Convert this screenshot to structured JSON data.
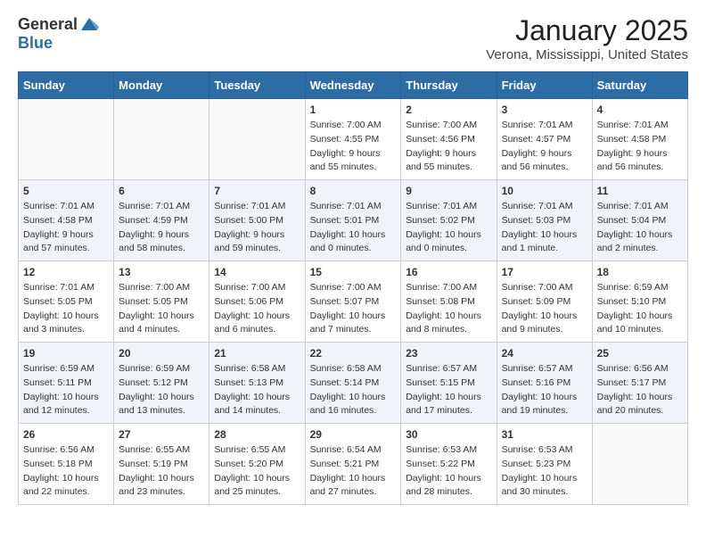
{
  "header": {
    "logo_line1": "General",
    "logo_line2": "Blue",
    "month": "January 2025",
    "location": "Verona, Mississippi, United States"
  },
  "weekdays": [
    "Sunday",
    "Monday",
    "Tuesday",
    "Wednesday",
    "Thursday",
    "Friday",
    "Saturday"
  ],
  "weeks": [
    [
      {
        "day": "",
        "info": ""
      },
      {
        "day": "",
        "info": ""
      },
      {
        "day": "",
        "info": ""
      },
      {
        "day": "1",
        "info": "Sunrise: 7:00 AM\nSunset: 4:55 PM\nDaylight: 9 hours\nand 55 minutes."
      },
      {
        "day": "2",
        "info": "Sunrise: 7:00 AM\nSunset: 4:56 PM\nDaylight: 9 hours\nand 55 minutes."
      },
      {
        "day": "3",
        "info": "Sunrise: 7:01 AM\nSunset: 4:57 PM\nDaylight: 9 hours\nand 56 minutes."
      },
      {
        "day": "4",
        "info": "Sunrise: 7:01 AM\nSunset: 4:58 PM\nDaylight: 9 hours\nand 56 minutes."
      }
    ],
    [
      {
        "day": "5",
        "info": "Sunrise: 7:01 AM\nSunset: 4:58 PM\nDaylight: 9 hours\nand 57 minutes."
      },
      {
        "day": "6",
        "info": "Sunrise: 7:01 AM\nSunset: 4:59 PM\nDaylight: 9 hours\nand 58 minutes."
      },
      {
        "day": "7",
        "info": "Sunrise: 7:01 AM\nSunset: 5:00 PM\nDaylight: 9 hours\nand 59 minutes."
      },
      {
        "day": "8",
        "info": "Sunrise: 7:01 AM\nSunset: 5:01 PM\nDaylight: 10 hours\nand 0 minutes."
      },
      {
        "day": "9",
        "info": "Sunrise: 7:01 AM\nSunset: 5:02 PM\nDaylight: 10 hours\nand 0 minutes."
      },
      {
        "day": "10",
        "info": "Sunrise: 7:01 AM\nSunset: 5:03 PM\nDaylight: 10 hours\nand 1 minute."
      },
      {
        "day": "11",
        "info": "Sunrise: 7:01 AM\nSunset: 5:04 PM\nDaylight: 10 hours\nand 2 minutes."
      }
    ],
    [
      {
        "day": "12",
        "info": "Sunrise: 7:01 AM\nSunset: 5:05 PM\nDaylight: 10 hours\nand 3 minutes."
      },
      {
        "day": "13",
        "info": "Sunrise: 7:00 AM\nSunset: 5:05 PM\nDaylight: 10 hours\nand 4 minutes."
      },
      {
        "day": "14",
        "info": "Sunrise: 7:00 AM\nSunset: 5:06 PM\nDaylight: 10 hours\nand 6 minutes."
      },
      {
        "day": "15",
        "info": "Sunrise: 7:00 AM\nSunset: 5:07 PM\nDaylight: 10 hours\nand 7 minutes."
      },
      {
        "day": "16",
        "info": "Sunrise: 7:00 AM\nSunset: 5:08 PM\nDaylight: 10 hours\nand 8 minutes."
      },
      {
        "day": "17",
        "info": "Sunrise: 7:00 AM\nSunset: 5:09 PM\nDaylight: 10 hours\nand 9 minutes."
      },
      {
        "day": "18",
        "info": "Sunrise: 6:59 AM\nSunset: 5:10 PM\nDaylight: 10 hours\nand 10 minutes."
      }
    ],
    [
      {
        "day": "19",
        "info": "Sunrise: 6:59 AM\nSunset: 5:11 PM\nDaylight: 10 hours\nand 12 minutes."
      },
      {
        "day": "20",
        "info": "Sunrise: 6:59 AM\nSunset: 5:12 PM\nDaylight: 10 hours\nand 13 minutes."
      },
      {
        "day": "21",
        "info": "Sunrise: 6:58 AM\nSunset: 5:13 PM\nDaylight: 10 hours\nand 14 minutes."
      },
      {
        "day": "22",
        "info": "Sunrise: 6:58 AM\nSunset: 5:14 PM\nDaylight: 10 hours\nand 16 minutes."
      },
      {
        "day": "23",
        "info": "Sunrise: 6:57 AM\nSunset: 5:15 PM\nDaylight: 10 hours\nand 17 minutes."
      },
      {
        "day": "24",
        "info": "Sunrise: 6:57 AM\nSunset: 5:16 PM\nDaylight: 10 hours\nand 19 minutes."
      },
      {
        "day": "25",
        "info": "Sunrise: 6:56 AM\nSunset: 5:17 PM\nDaylight: 10 hours\nand 20 minutes."
      }
    ],
    [
      {
        "day": "26",
        "info": "Sunrise: 6:56 AM\nSunset: 5:18 PM\nDaylight: 10 hours\nand 22 minutes."
      },
      {
        "day": "27",
        "info": "Sunrise: 6:55 AM\nSunset: 5:19 PM\nDaylight: 10 hours\nand 23 minutes."
      },
      {
        "day": "28",
        "info": "Sunrise: 6:55 AM\nSunset: 5:20 PM\nDaylight: 10 hours\nand 25 minutes."
      },
      {
        "day": "29",
        "info": "Sunrise: 6:54 AM\nSunset: 5:21 PM\nDaylight: 10 hours\nand 27 minutes."
      },
      {
        "day": "30",
        "info": "Sunrise: 6:53 AM\nSunset: 5:22 PM\nDaylight: 10 hours\nand 28 minutes."
      },
      {
        "day": "31",
        "info": "Sunrise: 6:53 AM\nSunset: 5:23 PM\nDaylight: 10 hours\nand 30 minutes."
      },
      {
        "day": "",
        "info": ""
      }
    ]
  ]
}
